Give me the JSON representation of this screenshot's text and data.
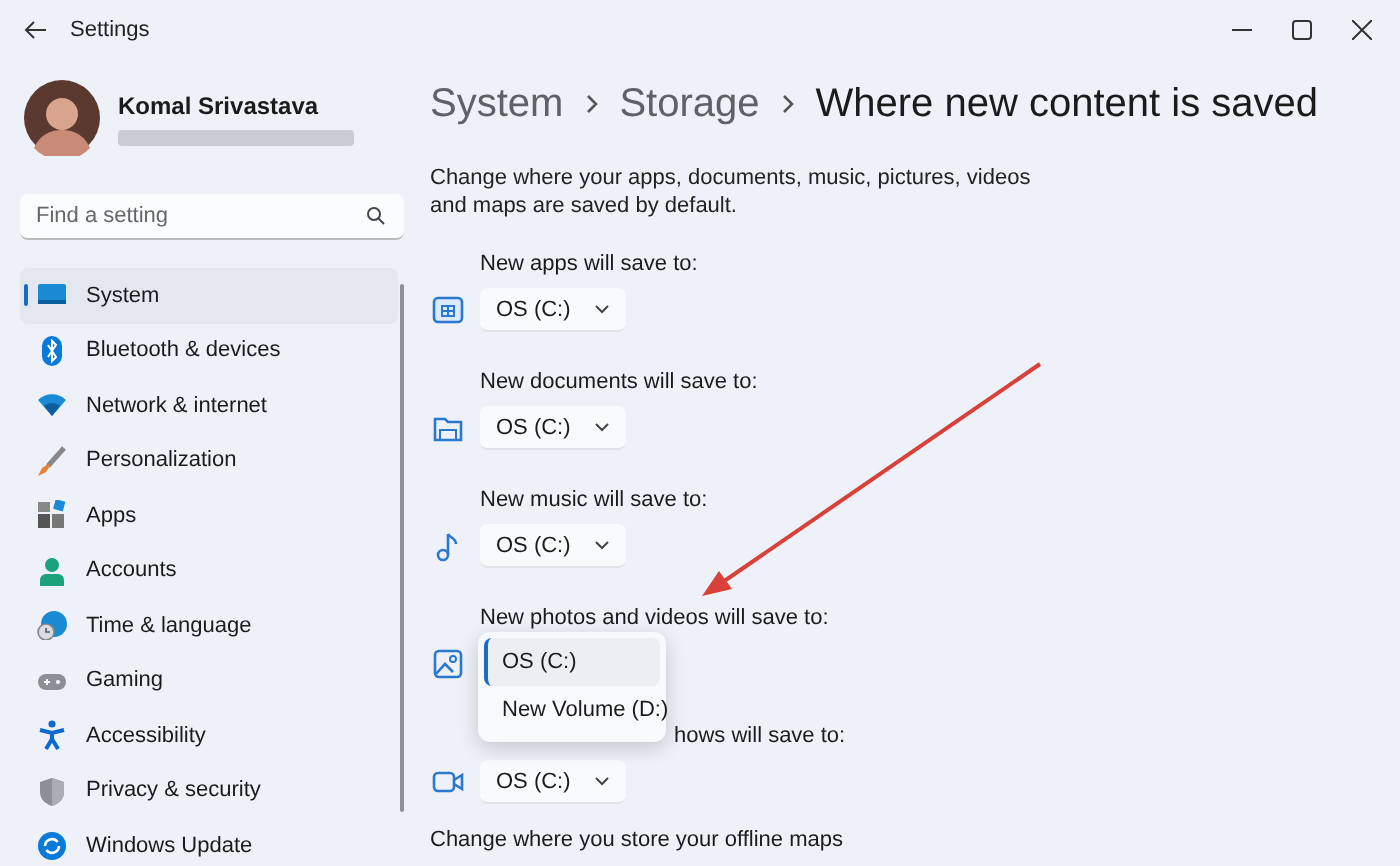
{
  "window": {
    "title": "Settings"
  },
  "user": {
    "name": "Komal Srivastava"
  },
  "search": {
    "placeholder": "Find a setting"
  },
  "nav": [
    {
      "label": "System",
      "selected": true
    },
    {
      "label": "Bluetooth & devices",
      "selected": false
    },
    {
      "label": "Network & internet",
      "selected": false
    },
    {
      "label": "Personalization",
      "selected": false
    },
    {
      "label": "Apps",
      "selected": false
    },
    {
      "label": "Accounts",
      "selected": false
    },
    {
      "label": "Time & language",
      "selected": false
    },
    {
      "label": "Gaming",
      "selected": false
    },
    {
      "label": "Accessibility",
      "selected": false
    },
    {
      "label": "Privacy & security",
      "selected": false
    },
    {
      "label": "Windows Update",
      "selected": false
    }
  ],
  "breadcrumb": [
    {
      "label": "System",
      "current": false
    },
    {
      "label": "Storage",
      "current": false
    },
    {
      "label": "Where new content is saved",
      "current": true
    }
  ],
  "description": "Change where your apps, documents, music, pictures, videos and maps are saved by default.",
  "locations": [
    {
      "label": "New apps will save to:",
      "value": "OS (C:)",
      "expanded": false
    },
    {
      "label": "New documents will save to:",
      "value": "OS (C:)",
      "expanded": false
    },
    {
      "label": "New music will save to:",
      "value": "OS (C:)",
      "expanded": false
    },
    {
      "label": "New photos and videos will save to:",
      "expanded": true,
      "options": [
        {
          "label": "OS (C:)",
          "selected": true
        },
        {
          "label": "New Volume (D:)",
          "selected": false
        }
      ]
    },
    {
      "label": "hows will save to:",
      "partly_covered": true,
      "value": "OS (C:)",
      "expanded": false
    }
  ],
  "footer_text": "Change where you store your offline maps"
}
